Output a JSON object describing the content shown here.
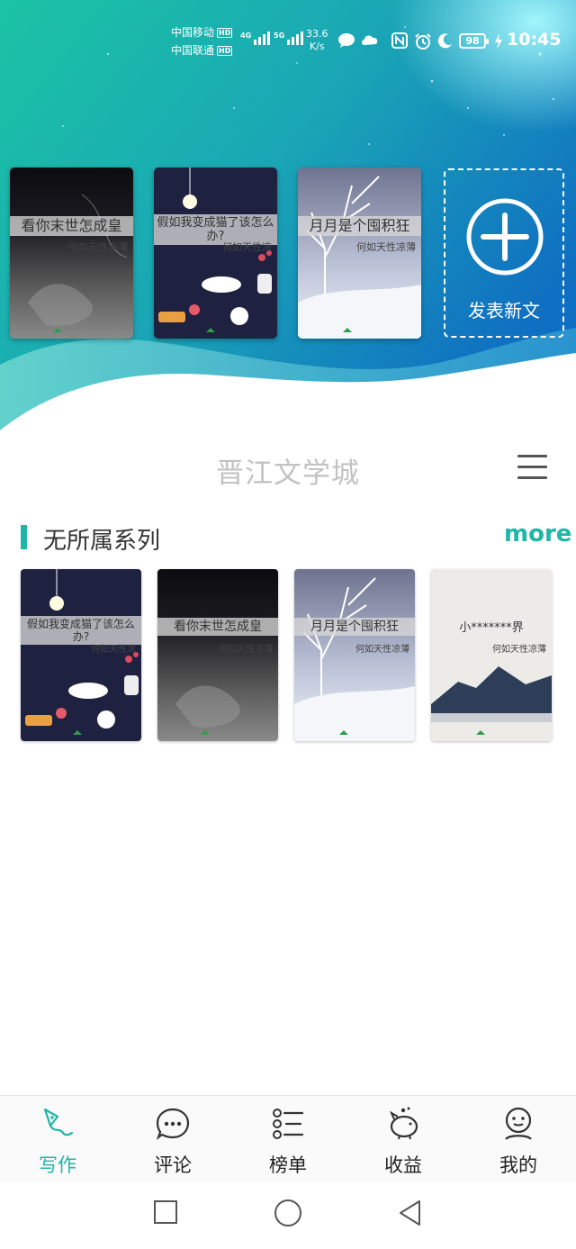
{
  "status_bar": {
    "carrier_1": "中国移动",
    "carrier_2": "中国联通",
    "hd_label": "HD",
    "net_1": "4G",
    "net_2": "5G",
    "speed_value": "33.6",
    "speed_unit": "K/s",
    "battery": "98",
    "time": "10:45"
  },
  "drafts": [
    {
      "title": "看你末世怎成皇",
      "author": "何如天性凉薄"
    },
    {
      "title": "假如我变成猫了该怎么办?",
      "author": "何如天性凉"
    },
    {
      "title": "月月是个囤积狂",
      "author": "何如天性凉薄"
    }
  ],
  "new_post": {
    "label": "发表新文",
    "icon": "plus-circle-icon"
  },
  "header": {
    "title": "晋江文学城",
    "menu_icon": "hamburger-menu-icon"
  },
  "series": {
    "title": "无所属系列",
    "more_label": "more",
    "books": [
      {
        "title": "假如我变成猫了该怎么办?",
        "author": "何如天性凉"
      },
      {
        "title": "看你末世怎成皇",
        "author": "何如天性凉薄"
      },
      {
        "title": "月月是个囤积狂",
        "author": "何如天性凉薄"
      },
      {
        "title": "小*******界",
        "author": "何如天性凉薄"
      }
    ]
  },
  "tabs": [
    {
      "label": "写作",
      "icon": "pen-write-icon",
      "active": true
    },
    {
      "label": "评论",
      "icon": "comment-bubble-icon",
      "active": false
    },
    {
      "label": "榜单",
      "icon": "ranking-list-icon",
      "active": false
    },
    {
      "label": "收益",
      "icon": "piggy-bank-icon",
      "active": false
    },
    {
      "label": "我的",
      "icon": "profile-face-icon",
      "active": false
    }
  ],
  "nav_bar": {
    "icons": [
      "recent-apps-icon",
      "home-icon",
      "back-icon"
    ]
  },
  "colors": {
    "accent": "#1fb6a8",
    "hero_top": "#18b8a6",
    "hero_right": "#1274c4"
  }
}
